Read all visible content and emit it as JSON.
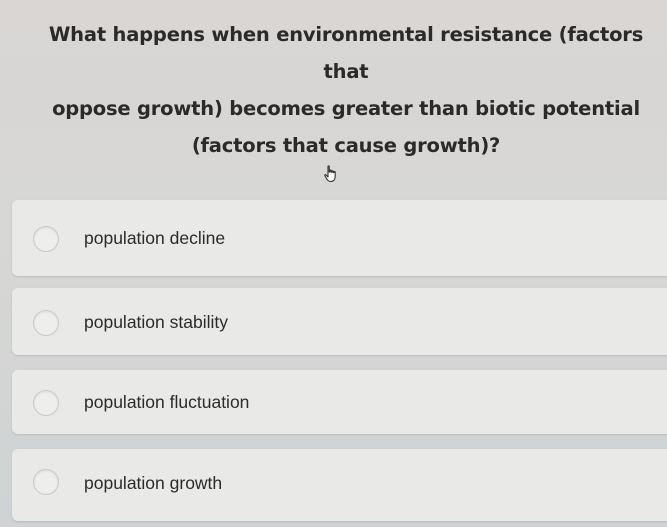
{
  "question": {
    "lines": [
      "What happens when environmental resistance (factors that",
      "oppose growth) becomes greater than biotic potential",
      "(factors that cause growth)?"
    ]
  },
  "options": [
    {
      "label": "population decline",
      "selected": false
    },
    {
      "label": "population stability",
      "selected": false
    },
    {
      "label": "population fluctuation",
      "selected": false
    },
    {
      "label": "population growth",
      "selected": false
    }
  ],
  "cursor": {
    "icon": "hand-pointer-icon"
  }
}
